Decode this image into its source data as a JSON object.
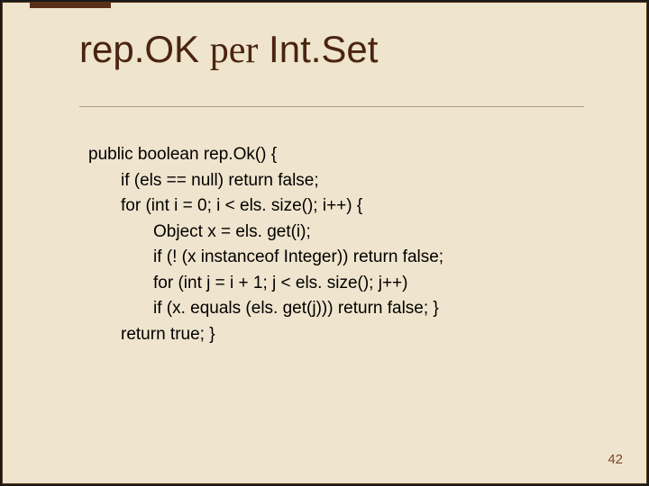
{
  "title": {
    "part1": "rep.OK ",
    "part2_serif": "per",
    "part3": " Int.Set"
  },
  "code": {
    "l0": "public boolean rep.Ok() {",
    "l1": "if (els == null) return false;",
    "l2": "for (int i = 0; i < els. size(); i++)  {",
    "l3": "Object x = els. get(i);",
    "l4": "if (! (x instanceof Integer)) return false;",
    "l5": "for (int j = i + 1; j < els. size(); j++)",
    "l6": "if (x. equals (els. get(j))) return false; }",
    "l7": "return true; }"
  },
  "page_number": "42"
}
